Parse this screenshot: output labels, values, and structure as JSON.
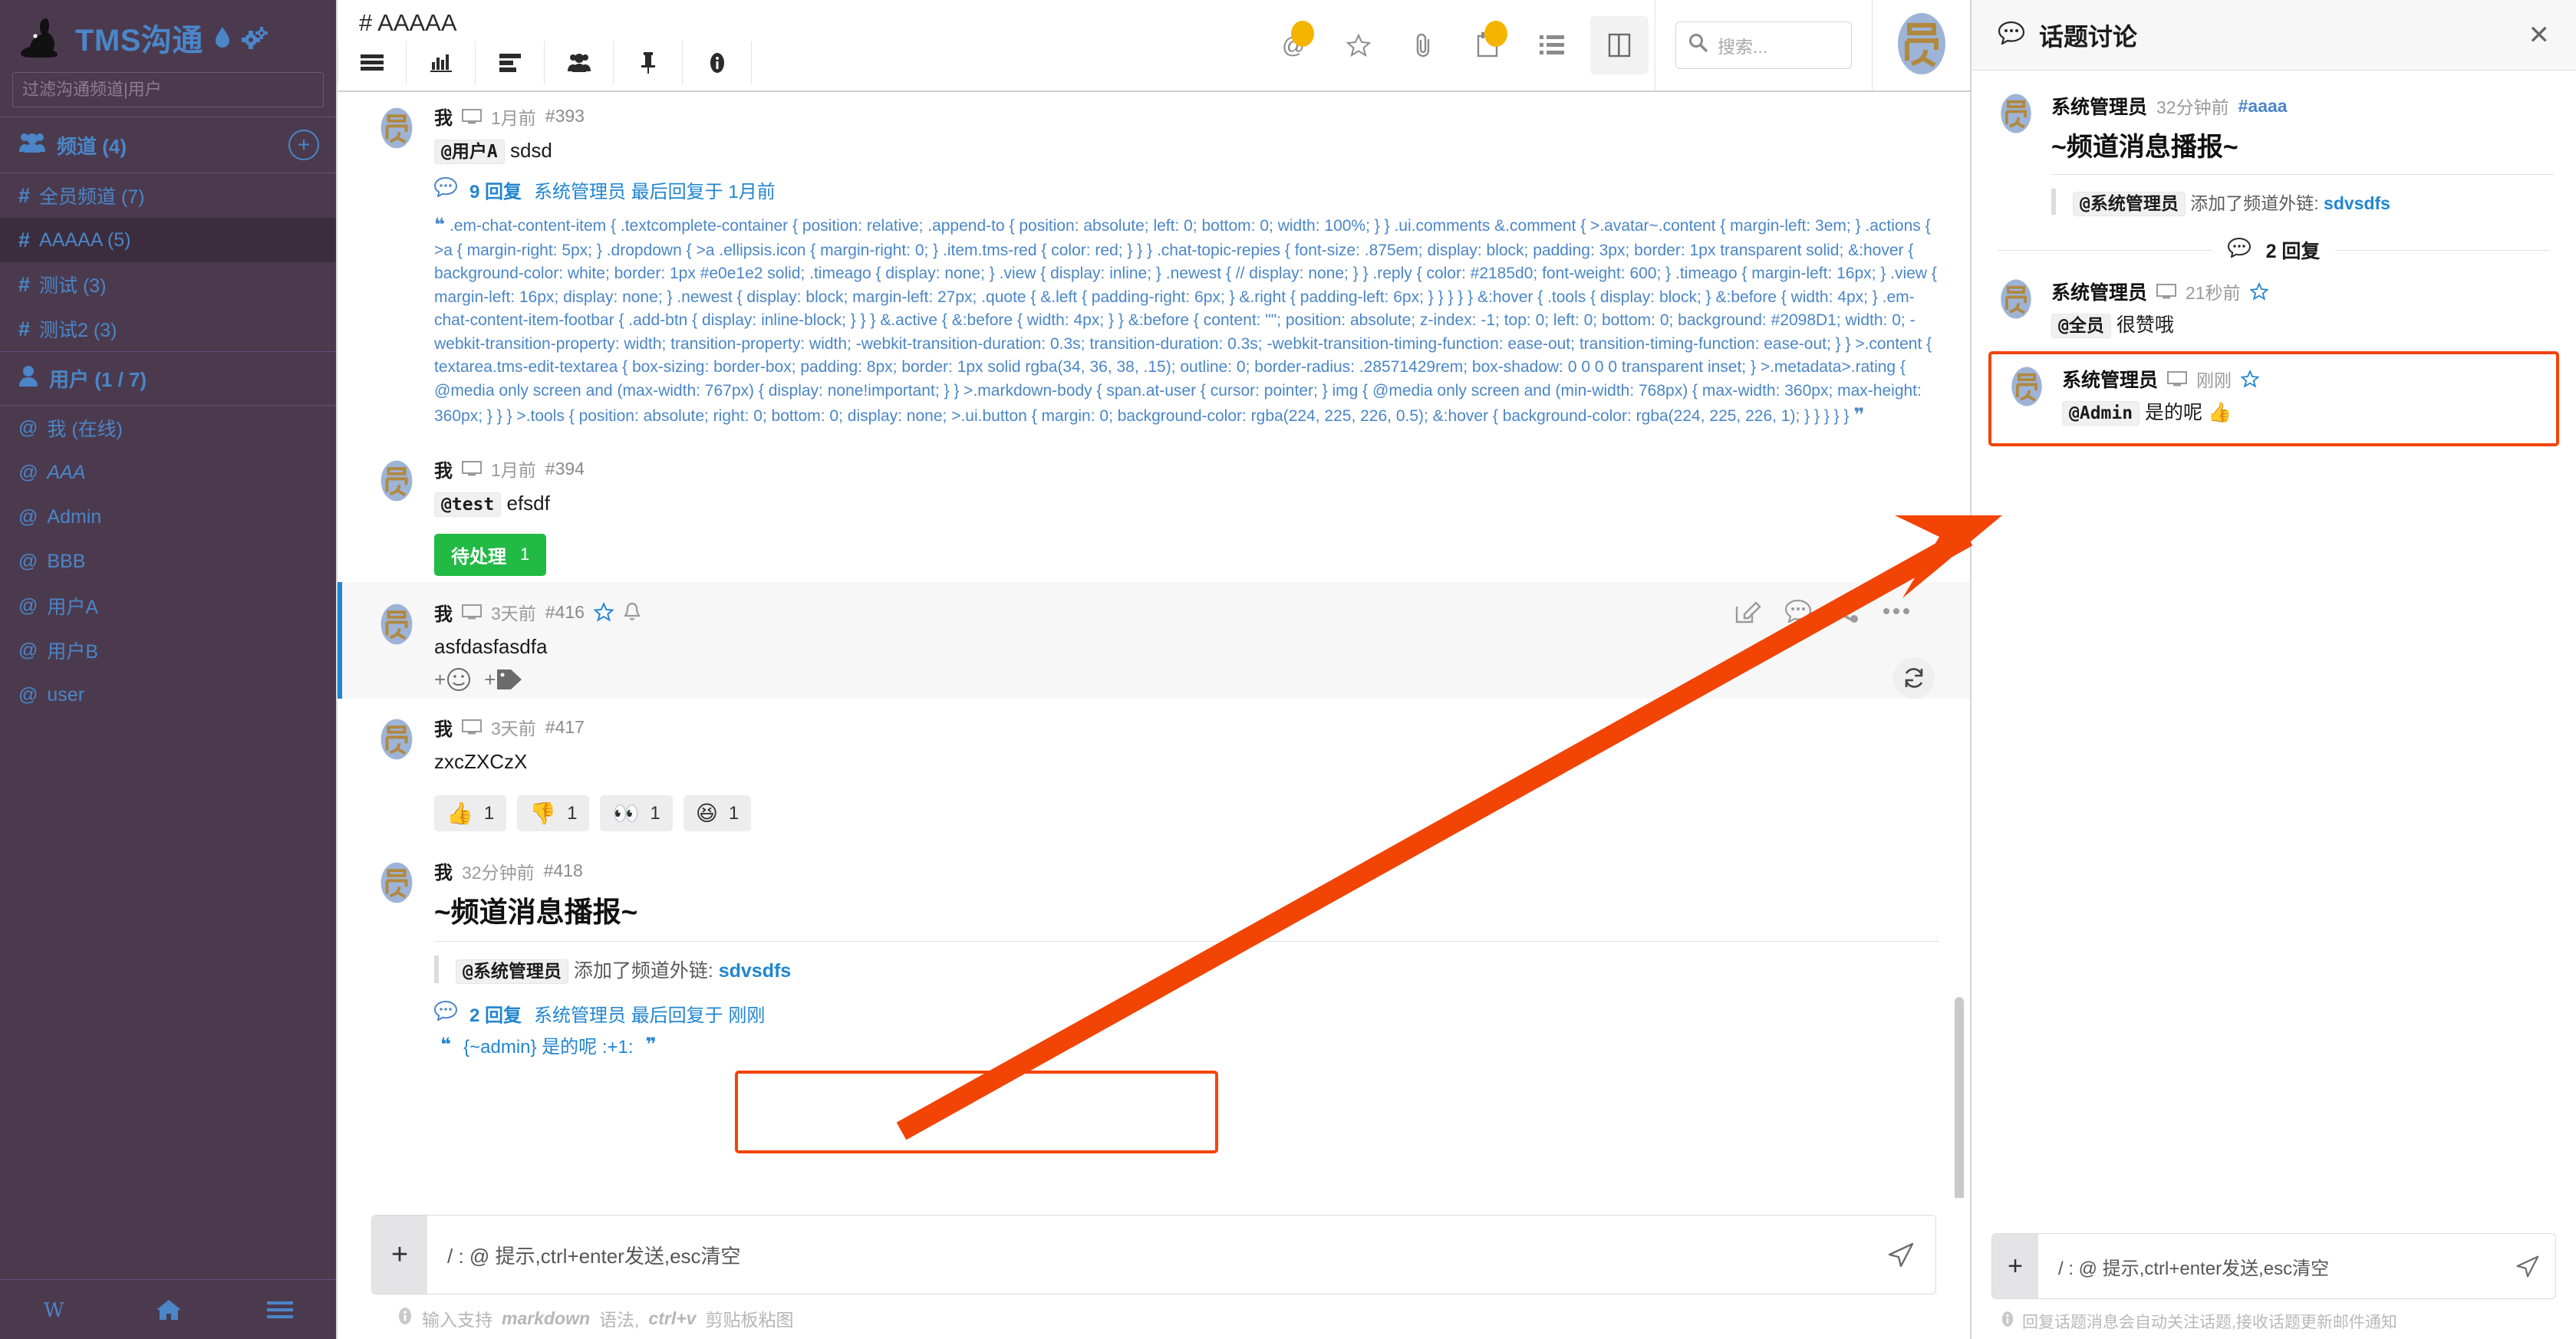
{
  "sidebar": {
    "brand": "TMS沟通",
    "filter_placeholder": "过滤沟通频道|用户",
    "channels_header": "频道 (4)",
    "channels": [
      {
        "label": "全员频道 (7)",
        "active": false,
        "italic": false
      },
      {
        "label": "AAAAA (5)",
        "active": true,
        "italic": false
      },
      {
        "label": "测试 (3)",
        "active": false,
        "italic": false
      },
      {
        "label": "测试2 (3)",
        "active": false,
        "italic": false
      }
    ],
    "users_header": "用户 (1 / 7)",
    "users": [
      {
        "label": "我 (在线)",
        "italic": false
      },
      {
        "label": "AAA",
        "italic": true
      },
      {
        "label": "Admin",
        "italic": false
      },
      {
        "label": "BBB",
        "italic": false
      },
      {
        "label": "用户A",
        "italic": false
      },
      {
        "label": "用户B",
        "italic": false
      },
      {
        "label": "user",
        "italic": false
      }
    ]
  },
  "topbar": {
    "channel_title": "# AAAAA",
    "tools": [
      "menu-icon",
      "chart-icon",
      "list-detail-icon",
      "members-icon",
      "pin-icon",
      "info-icon"
    ],
    "right_icons": [
      "mention-icon",
      "star-icon",
      "paperclip-icon",
      "notes-icon",
      "list-icon",
      "split-panel-icon"
    ],
    "search_placeholder": "搜索..."
  },
  "messages": [
    {
      "author": "我",
      "device": "desktop-icon",
      "time": "1月前",
      "id": "#393",
      "mention": "@用户A",
      "text": "sdsd",
      "replies_count": "9 回复",
      "replies_meta": "系统管理员 最后回复于 1月前",
      "quote": ".em-chat-content-item { .textcomplete-container { position: relative; .append-to { position: absolute; left: 0; bottom: 0; width: 100%; } } .ui.comments &.comment { >.avatar~.content { margin-left: 3em; } .actions { >a { margin-right: 5px; } .dropdown { >a .ellipsis.icon { margin-right: 0; } .item.tms-red { color: red; } } } .chat-topic-repies { font-size: .875em; display: block; padding: 3px; border: 1px transparent solid; &:hover { background-color: white; border: 1px #e0e1e2 solid; .timeago { display: none; } .view { display: inline; } .newest { // display: none; } } .reply { color: #2185d0; font-weight: 600; } .timeago { margin-left: 16px; } .view { margin-left: 16px; display: none; } .newest { display: block; margin-left: 27px; .quote { &.left { padding-right: 6px; } &.right { padding-left: 6px; } } } } } &:hover { .tools { display: block; } &:before { width: 4px; } .em-chat-content-item-footbar { .add-btn { display: inline-block; } } } &.active { &:before { width: 4px; } } &:before { content: \"\"; position: absolute; z-index: -1; top: 0; left: 0; bottom: 0; background: #2098D1; width: 0; -webkit-transition-property: width; transition-property: width; -webkit-transition-duration: 0.3s; transition-duration: 0.3s; -webkit-transition-timing-function: ease-out; transition-timing-function: ease-out; } } >.content { textarea.tms-edit-textarea { box-sizing: border-box; padding: 8px; border: 1px solid rgba(34, 36, 38, .15); outline: 0; border-radius: .28571429rem; box-shadow: 0 0 0 0 transparent inset; } >.metadata>.rating { @media only screen and (max-width: 767px) { display: none!important; } } >.markdown-body { span.at-user { cursor: pointer; } img { @media only screen and (min-width: 768px) { max-width: 360px; max-height: 360px; } } } >.tools { position: absolute; right: 0; bottom: 0; display: none; >.ui.button { margin: 0; background-color: rgba(224, 225, 226, 0.5); &:hover { background-color: rgba(224, 225, 226, 1); } } } } }"
    },
    {
      "author": "我",
      "device": "desktop-icon",
      "time": "1月前",
      "id": "#394",
      "mention": "@test",
      "text": "efsdf",
      "status_label": "待处理",
      "status_count": "1"
    },
    {
      "author": "我",
      "device": "desktop-icon",
      "time": "3天前",
      "id": "#416",
      "text": "asfdasfasdfa",
      "has_star": true,
      "has_bell": true,
      "tools": [
        "edit-icon",
        "comment-icon",
        "share-icon",
        "ellipsis-icon"
      ],
      "add_buttons": [
        "add-emoji-icon",
        "add-tag-icon"
      ]
    },
    {
      "author": "我",
      "device": "desktop-icon",
      "time": "3天前",
      "id": "#417",
      "text": "zxcZXCzX",
      "reactions": [
        {
          "emoji": "👍",
          "count": "1"
        },
        {
          "emoji": "👎",
          "count": "1"
        },
        {
          "emoji": "👀",
          "count": "1"
        },
        {
          "emoji": "😆",
          "count": "1"
        }
      ]
    },
    {
      "author": "我",
      "time": "32分钟前",
      "id": "#418",
      "title": "~频道消息播报~",
      "quote_mention": "@系统管理员",
      "quote_text": "添加了频道外链:",
      "quote_link": "sdvsdfs",
      "replies_count": "2 回复",
      "replies_meta": "系统管理员 最后回复于 刚刚",
      "replies_preview": "{~admin} 是的呢 :+1:"
    }
  ],
  "composer": {
    "plus": "+",
    "placeholder": "/ : @ 提示,ctrl+enter发送,esc清空",
    "hint_prefix": "输入支持",
    "hint_md": "markdown",
    "hint_mid": "语法,",
    "hint_ctrl": "ctrl+v",
    "hint_suffix": "剪贴板粘图",
    "send": "send-icon"
  },
  "right_panel": {
    "title": "话题讨论",
    "close": "✕",
    "root": {
      "author": "系统管理员",
      "time": "32分钟前",
      "channel": "#aaaa",
      "title": "~频道消息播报~",
      "quote_mention": "@系统管理员",
      "quote_text": "添加了频道外链:",
      "quote_link": "sdvsdfs"
    },
    "divider": "2 回复",
    "replies": [
      {
        "author": "系统管理员",
        "device": "desktop-icon",
        "time": "21秒前",
        "mention": "@全员",
        "text": "很赞哦",
        "highlighted": false
      },
      {
        "author": "系统管理员",
        "device": "desktop-icon",
        "time": "刚刚",
        "mention": "@Admin",
        "text": "是的呢 👍",
        "highlighted": true
      }
    ],
    "composer": {
      "plus": "+",
      "placeholder": "/ : @ 提示,ctrl+enter发送,esc清空",
      "hint": "回复话题消息会自动关注话题,接收话题更新邮件通知"
    }
  },
  "colors": {
    "sidebar_bg": "#4b3a4e",
    "accent_blue": "#4a86c8",
    "link_blue": "#2185d0",
    "status_green": "#21ba45",
    "highlight_red": "#f24405",
    "badge_yellow": "#f5b400"
  }
}
